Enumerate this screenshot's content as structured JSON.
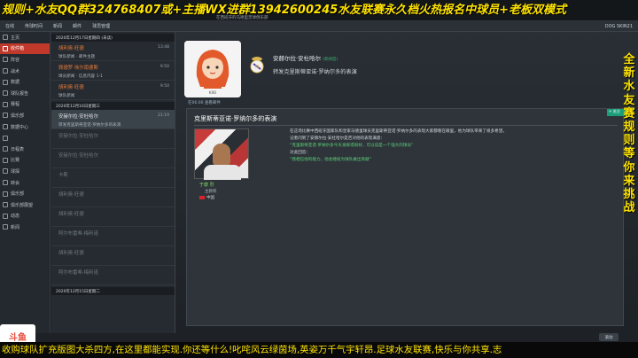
{
  "banner_top": "规则+水友QQ群324768407或+主播WX进群13942600245水友联赛永久档火热报名中球员+老板双模式",
  "window_title": "在西班牙的马德里足球俱乐部",
  "menu": [
    "在线",
    "传球时间",
    "新闻",
    "邮件",
    "球员管理"
  ],
  "menu_right": "DOG SKIN21",
  "sidebar": {
    "items": [
      "主页",
      "收件箱",
      "阵容",
      "战术",
      "数据",
      "球队报告",
      "赛程",
      "俱乐部",
      "数据中心",
      "",
      "日程表",
      "比赛",
      "球探",
      "转会",
      "俱乐部",
      "俱乐部展望",
      "动态",
      "新闻"
    ]
  },
  "messages": {
    "group1": "2020年12月17日星期四 (未读)",
    "group2": "2020年12月16日星期三",
    "items": [
      {
        "sender": "胡利奥·旺德",
        "subject": "球队新闻 · 邮件主题",
        "time": "13:48",
        "sel": false,
        "dim": false
      },
      {
        "sender": "佩德罗·埃尔南德斯",
        "subject": "球员新闻 · 信息内容 1-1",
        "time": "9:50",
        "sel": false,
        "dim": false
      },
      {
        "sender": "胡利奥·旺德",
        "subject": "球队新闻",
        "time": "9:50",
        "sel": false,
        "dim": false
      },
      {
        "sender": "安赫尔拉·安杜哈尔",
        "subject": "转发克里斯蒂亚诺·罗纳尔多的表演",
        "time": "21:19",
        "sel": true,
        "dim": false
      },
      {
        "sender": "安赫尔拉·安杜哈尔",
        "subject": "",
        "time": "",
        "sel": false,
        "dim": true
      },
      {
        "sender": "安赫尔拉·安杜哈尔",
        "subject": "",
        "time": "",
        "sel": false,
        "dim": true
      },
      {
        "sender": "卡斯",
        "subject": "",
        "time": "",
        "sel": false,
        "dim": true
      },
      {
        "sender": "胡利奥·旺德",
        "subject": "",
        "time": "",
        "sel": false,
        "dim": true
      },
      {
        "sender": "胡利奥·旺德",
        "subject": "",
        "time": "",
        "sel": false,
        "dim": true
      },
      {
        "sender": "阿尔布雷希·梅利诺",
        "subject": "",
        "time": "",
        "sel": false,
        "dim": true
      },
      {
        "sender": "胡利奥·旺德",
        "subject": "",
        "time": "",
        "sel": false,
        "dim": true
      },
      {
        "sender": "阿尔布雷希·梅利诺",
        "subject": "",
        "time": "",
        "sel": false,
        "dim": true
      }
    ],
    "group3": "2020年12月15日星期二"
  },
  "header": {
    "avatar_name": "KIKI",
    "sender_name": "安赫尔拉·安杜哈尔",
    "sender_tag": "(新闻官)",
    "subject": "转发克里斯蒂亚诺·罗纳尔多的表演"
  },
  "received": "在06:00 查看邮件",
  "content": {
    "title": "克里斯蒂亚诺·罗纳尔多的表演",
    "ticker": "+ 关注",
    "player_name": "于康 烈",
    "player_pos": "主教练",
    "player_club": "中国",
    "body": [
      "在这场比赛中西班牙国家队和皇家马德里球员克里斯蒂亚诺·罗纳尔多的表现大家都看在眼里，他为球队带来了很多希望。",
      "记者问到了安赫尔拉·安杜哈尔是否对他的表现满意：",
      "“克里斯蒂亚诺·罗纳尔多今天发挥得很好，可以说是一个强大的球员”",
      "对此回答：",
      "“我相信他的能力，他会继续为球队做出贡献”"
    ]
  },
  "scroll_btn": "滚动",
  "right_banner": [
    "全",
    "新",
    "水",
    "友",
    "赛",
    "规",
    "则",
    "等",
    "你",
    "来",
    "挑",
    "战"
  ],
  "bottom_banner": "收购球队扩充版图大杀四方,在这里都能实现.你还等什么!叱咤风云绿茵场,英姿万千气宇轩昂.足球水友联赛,快乐与你共享.志",
  "logo": "斗鱼"
}
